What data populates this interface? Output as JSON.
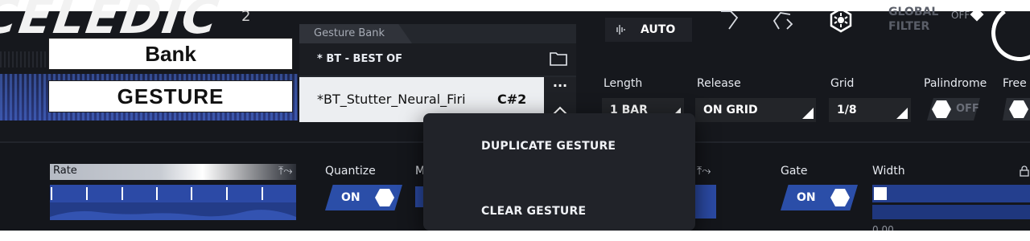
{
  "logo": {
    "text": "CELEDIC",
    "sup": "2"
  },
  "labels": {
    "bank": "Bank",
    "gesture": "GESTURE"
  },
  "bank_panel": {
    "caption": "Gesture Bank",
    "selected_bank": "* BT - BEST OF",
    "gesture_name": "*BT_Stutter_Neural_Firi",
    "gesture_note": "C#2",
    "more_label": "···"
  },
  "context_menu": {
    "items": [
      "DUPLICATE GESTURE",
      "CLEAR GESTURE"
    ]
  },
  "header": {
    "auto_label": "AUTO",
    "global_filter": [
      "GLOBAL",
      "FILTER"
    ],
    "global_filter_state": "OFF"
  },
  "params": {
    "length": {
      "label": "Length",
      "value": "1 BAR"
    },
    "release": {
      "label": "Release",
      "value": "ON GRID"
    },
    "grid": {
      "label": "Grid",
      "value": "1/8"
    },
    "palindrome": {
      "label": "Palindrome",
      "state": "OFF"
    },
    "freeze": {
      "label": "Free"
    }
  },
  "lower": {
    "rate_label": "Rate",
    "quantize_label": "Quantize",
    "quantize_state": "ON",
    "mod_label": "M",
    "gate_label": "Gate",
    "gate_state": "ON",
    "width_label": "Width",
    "width_value": "0.00"
  },
  "colors": {
    "accent_blue": "#2b4ea8",
    "panel_dark": "#16181d",
    "popup": "#212329"
  }
}
